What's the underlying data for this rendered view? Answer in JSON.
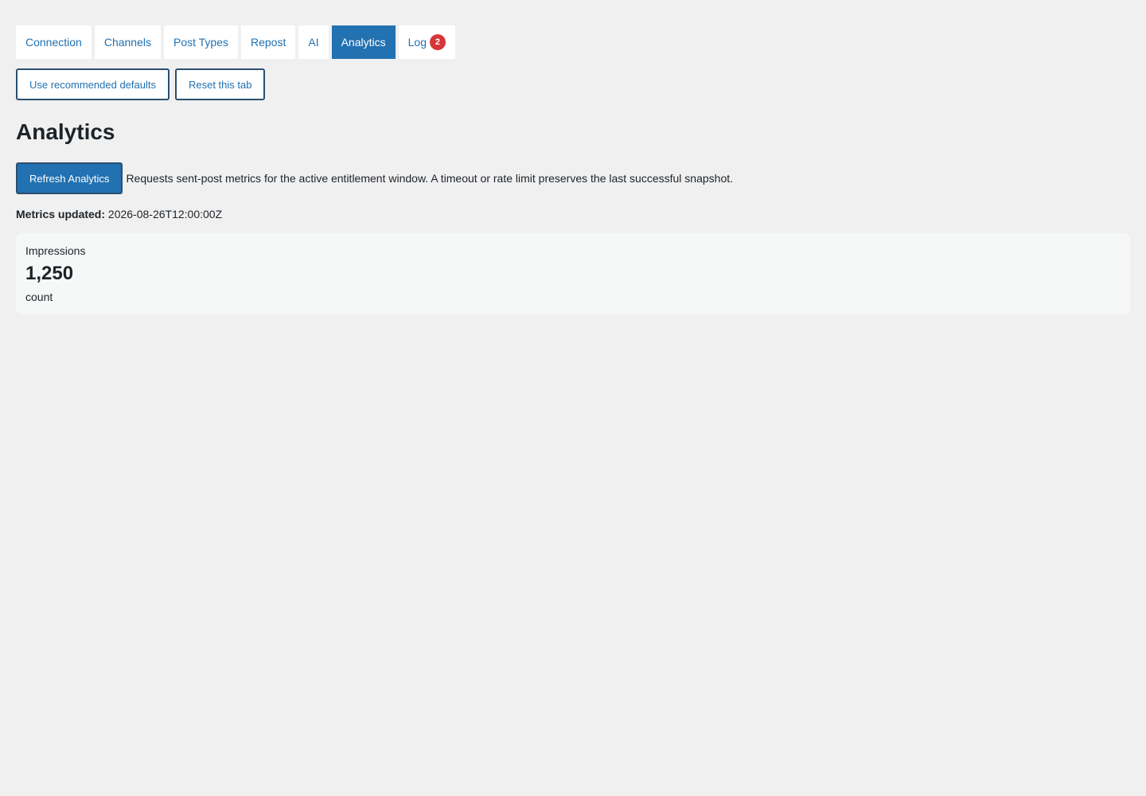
{
  "tabs": [
    {
      "label": "Connection",
      "active": false
    },
    {
      "label": "Channels",
      "active": false
    },
    {
      "label": "Post Types",
      "active": false
    },
    {
      "label": "Repost",
      "active": false
    },
    {
      "label": "AI",
      "active": false
    },
    {
      "label": "Analytics",
      "active": true
    },
    {
      "label": "Log",
      "active": false,
      "badge": "2"
    }
  ],
  "toolbar": {
    "defaults_label": "Use recommended defaults",
    "reset_label": "Reset this tab"
  },
  "page": {
    "title": "Analytics"
  },
  "refresh": {
    "button_label": "Refresh Analytics",
    "description": "Requests sent-post metrics for the active entitlement window. A timeout or rate limit preserves the last successful snapshot."
  },
  "metrics_updated": {
    "label": "Metrics updated:",
    "value": "2026-08-26T12:00:00Z"
  },
  "metric": {
    "label": "Impressions",
    "value": "1,250",
    "unit": "count"
  },
  "colors": {
    "accent": "#2271b1",
    "badge": "#d63638",
    "background": "#f0f0f1",
    "card": "#f6f7f7"
  }
}
